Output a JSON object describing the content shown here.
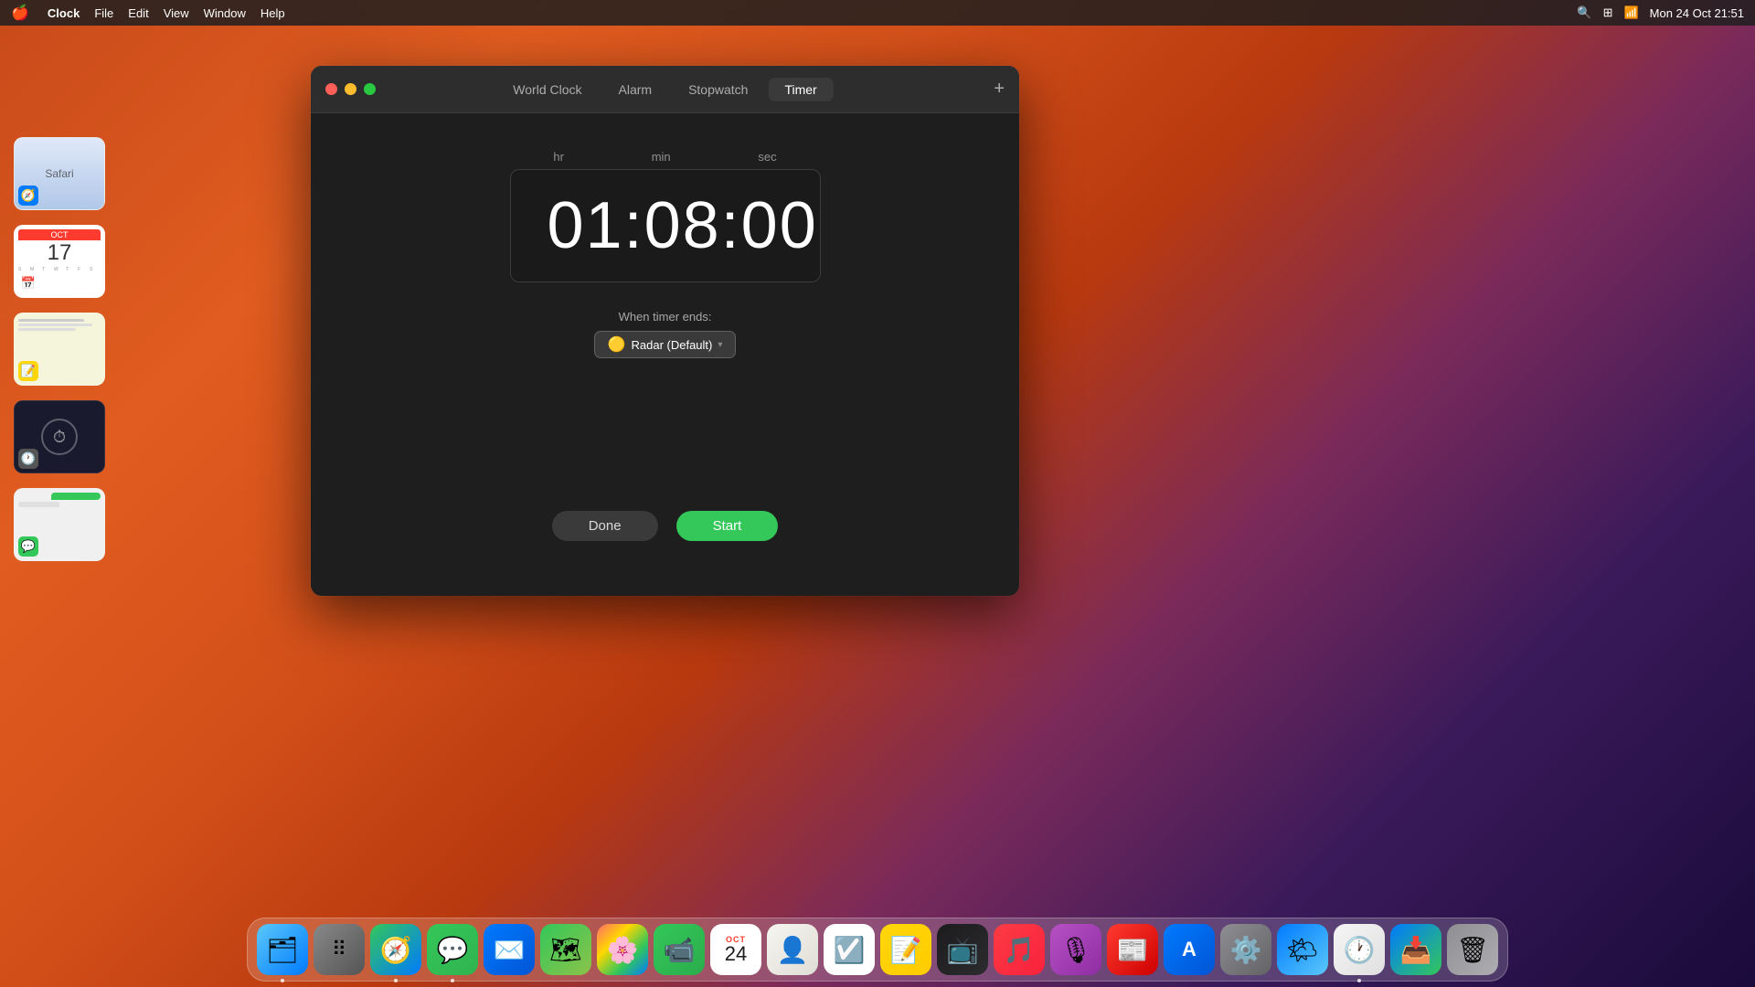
{
  "menubar": {
    "apple": "🍎",
    "items": [
      "Clock",
      "File",
      "Edit",
      "View",
      "Window",
      "Help"
    ],
    "app_name": "Clock",
    "right": [
      "🔍",
      "📋",
      "Mon 24 Oct  21:51"
    ]
  },
  "clock_window": {
    "tabs": [
      {
        "label": "World Clock",
        "active": false
      },
      {
        "label": "Alarm",
        "active": false
      },
      {
        "label": "Stopwatch",
        "active": false
      },
      {
        "label": "Timer",
        "active": true
      }
    ],
    "add_label": "+",
    "timer": {
      "label_hr": "hr",
      "label_min": "min",
      "label_sec": "sec",
      "display": "01:08:00",
      "when_ends_label": "When timer ends:",
      "sound_label": "Radar (Default)",
      "sound_emoji": "🟡",
      "btn_done": "Done",
      "btn_start": "Start"
    }
  },
  "dock": {
    "items": [
      {
        "name": "Finder",
        "emoji": "🗂"
      },
      {
        "name": "Launchpad",
        "emoji": "🚀"
      },
      {
        "name": "Safari",
        "emoji": "🧭"
      },
      {
        "name": "Messages",
        "emoji": "💬"
      },
      {
        "name": "Mail",
        "emoji": "✉️"
      },
      {
        "name": "Maps",
        "emoji": "🗺"
      },
      {
        "name": "Photos",
        "emoji": "🌸"
      },
      {
        "name": "FaceTime",
        "emoji": "📹"
      },
      {
        "name": "Calendar",
        "emoji": "📅",
        "date": "24"
      },
      {
        "name": "Contacts",
        "emoji": "👤"
      },
      {
        "name": "Reminders",
        "emoji": "☑️"
      },
      {
        "name": "Notes",
        "emoji": "📝"
      },
      {
        "name": "Apple TV",
        "emoji": "📺"
      },
      {
        "name": "Music",
        "emoji": "🎵"
      },
      {
        "name": "Podcasts",
        "emoji": "🎙"
      },
      {
        "name": "News",
        "emoji": "📰"
      },
      {
        "name": "App Store",
        "emoji": "🅰"
      },
      {
        "name": "System Preferences",
        "emoji": "⚙️"
      },
      {
        "name": "Weather",
        "emoji": "🌤"
      },
      {
        "name": "Clock",
        "emoji": "🕐"
      },
      {
        "name": "AirDrop",
        "emoji": "📥"
      },
      {
        "name": "Trash",
        "emoji": "🗑"
      }
    ]
  },
  "recent_apps": [
    {
      "label": "Safari",
      "emoji": "🧭",
      "bg": "safari"
    },
    {
      "label": "Calendar",
      "emoji": "📅",
      "bg": "calendar"
    },
    {
      "label": "Notes",
      "emoji": "📝",
      "bg": "notes"
    },
    {
      "label": "Clock Dark",
      "emoji": "🕐",
      "bg": "dark"
    },
    {
      "label": "Messages",
      "emoji": "💬",
      "bg": "message"
    }
  ]
}
